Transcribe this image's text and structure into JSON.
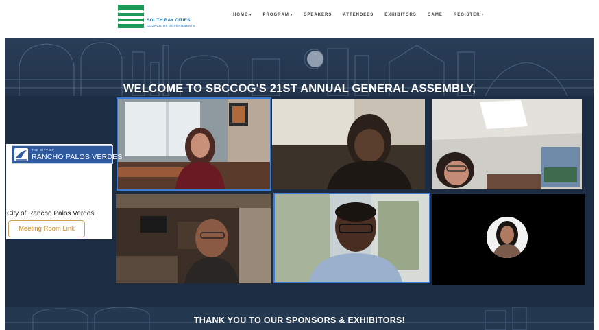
{
  "header": {
    "logo_line1": "SOUTH BAY CITIES",
    "logo_line2": "COUNCIL OF GOVERNMENTS",
    "nav": [
      {
        "label": "HOME",
        "has_dropdown": true
      },
      {
        "label": "PROGRAM",
        "has_dropdown": true
      },
      {
        "label": "SPEAKERS",
        "has_dropdown": false
      },
      {
        "label": "ATTENDEES",
        "has_dropdown": false
      },
      {
        "label": "EXHIBITORS",
        "has_dropdown": false
      },
      {
        "label": "GAME",
        "has_dropdown": false
      },
      {
        "label": "REGISTER",
        "has_dropdown": true
      }
    ],
    "caret": "▾"
  },
  "hero": {
    "welcome": "WELCOME TO SBCCOG'S 21ST ANNUAL GENERAL ASSEMBLY,",
    "thanks": "THANK YOU TO OUR SPONSORS & EXHIBITORS!"
  },
  "sponsor_card": {
    "logo_small": "THE CITY OF",
    "logo_big": "RANCHO PALOS VERDES",
    "name": "City of Rancho Palos Verdes",
    "button_label": "Meeting Room Link"
  },
  "colors": {
    "brand_green": "#1c9a57",
    "brand_blue": "#1a6fb5",
    "hero_bg": "#1c2d43",
    "button_text": "#c98a2a"
  }
}
